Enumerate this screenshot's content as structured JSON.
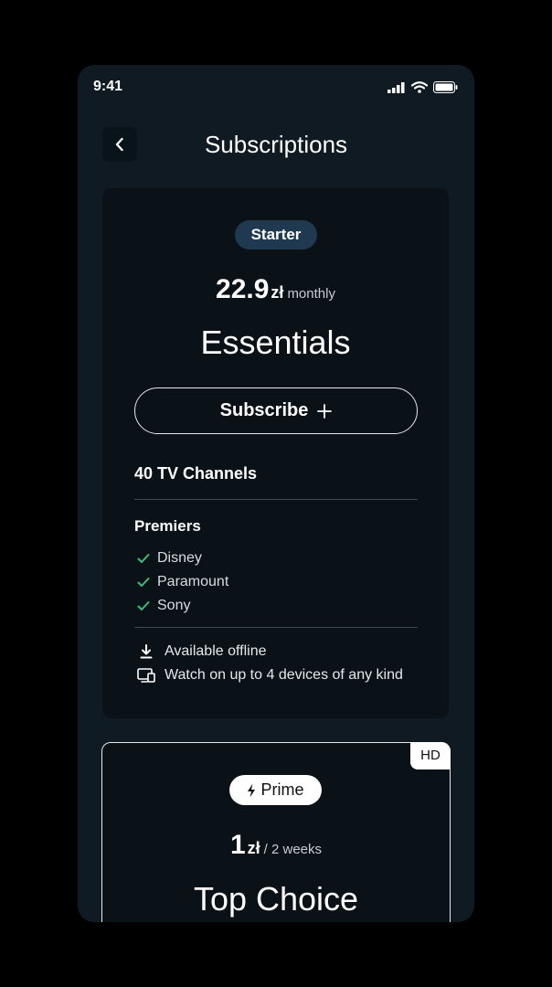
{
  "status_bar": {
    "time": "9:41"
  },
  "header": {
    "title": "Subscriptions"
  },
  "plans": [
    {
      "tier": "Starter",
      "price": "22.9",
      "currency": "zł",
      "period": "monthly",
      "name": "Essentials",
      "subscribe_label": "Subscribe",
      "channels": "40 TV Channels",
      "premiers_title": "Premiers",
      "premiers": [
        "Disney",
        "Paramount",
        "Sony"
      ],
      "features": [
        "Available offline",
        "Watch on up to 4 devices of any kind"
      ]
    },
    {
      "badge": "HD",
      "tier": "Prime",
      "price": "1",
      "currency": "zł",
      "period": "/ 2 weeks",
      "name": "Top Choice"
    }
  ],
  "colors": {
    "background": "#0f1a22",
    "card": "#0a1117",
    "accent": "#3dbb7a",
    "tier_badge": "#1f3a50"
  }
}
